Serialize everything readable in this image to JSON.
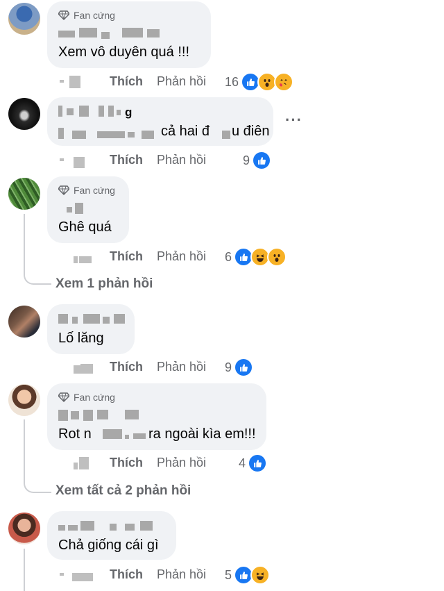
{
  "comments": [
    {
      "badge": "Fan cứng",
      "text": "Xem vô duyên quá !!!",
      "actions": {
        "like": "Thích",
        "reply": "Phản hồi"
      },
      "reactions": {
        "count": "16",
        "icons": [
          "like-icon",
          "wow-icon",
          "love-hug-icon"
        ]
      }
    },
    {
      "name_visible": "g",
      "text": "cả hai đ",
      "text_tail": "u điên",
      "more": "···",
      "actions": {
        "like": "Thích",
        "reply": "Phản hồi"
      },
      "reactions": {
        "count": "9",
        "icons": [
          "like-icon"
        ]
      }
    },
    {
      "badge": "Fan cứng",
      "text": "Ghê quá",
      "actions": {
        "like": "Thích",
        "reply": "Phản hồi"
      },
      "reactions": {
        "count": "6",
        "icons": [
          "like-icon",
          "haha-icon",
          "wow-icon"
        ]
      },
      "view_replies": "Xem 1 phản hồi"
    },
    {
      "text": "Lố lăng",
      "actions": {
        "like": "Thích",
        "reply": "Phản hồi"
      },
      "reactions": {
        "count": "9",
        "icons": [
          "like-icon"
        ]
      }
    },
    {
      "badge": "Fan cứng",
      "text": "Rot n",
      "text_tail": "ra ngoài kìa em!!!",
      "actions": {
        "like": "Thích",
        "reply": "Phản hồi"
      },
      "reactions": {
        "count": "4",
        "icons": [
          "like-icon"
        ]
      },
      "view_replies": "Xem tất cả 2 phản hồi"
    },
    {
      "text": "Chả giống cái gì",
      "actions": {
        "like": "Thích",
        "reply": "Phản hồi"
      },
      "reactions": {
        "count": "5",
        "icons": [
          "like-icon",
          "haha-icon"
        ]
      }
    }
  ],
  "colors": {
    "like": "#1877f2",
    "emoji": "#f7b125",
    "secondary_text": "#65676b",
    "bubble": "#f0f2f5"
  }
}
